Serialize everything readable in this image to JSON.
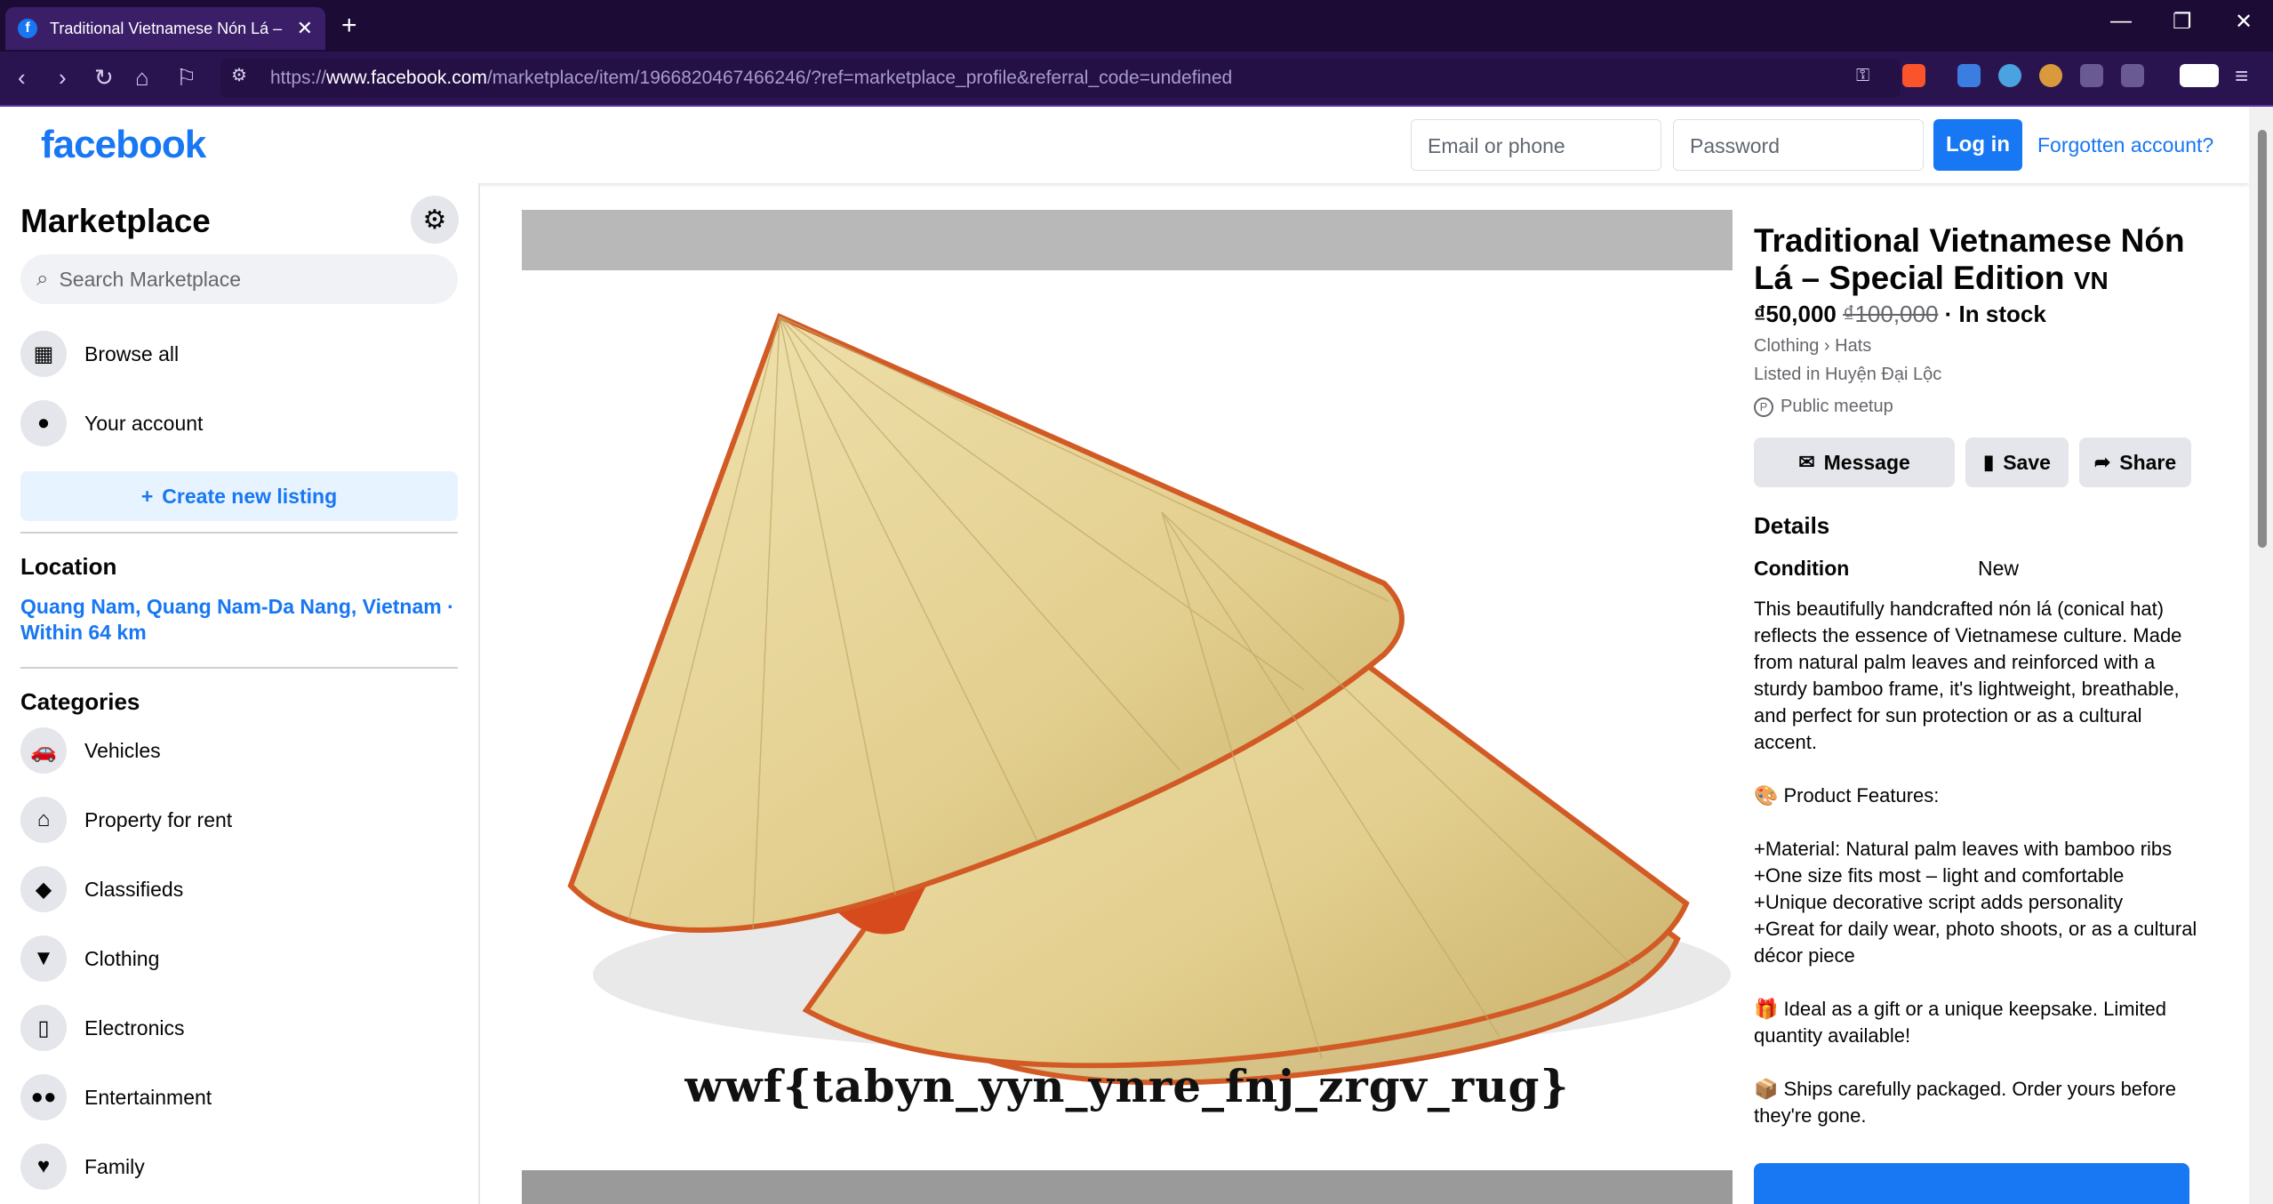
{
  "browser": {
    "tab_title": "Traditional Vietnamese Nón Lá –",
    "url_prefix": "https://",
    "url_host": "www.facebook.com",
    "url_path": "/marketplace/item/1966820467466246/?ref=marketplace_profile&referral_code=undefined"
  },
  "header": {
    "logo": "facebook",
    "email_placeholder": "Email or phone",
    "password_placeholder": "Password",
    "login_label": "Log in",
    "forgot_label": "Forgotten account?"
  },
  "sidebar": {
    "title": "Marketplace",
    "search_placeholder": "Search Marketplace",
    "browse_all": "Browse all",
    "your_account": "Your account",
    "create_listing": "Create new listing",
    "location_title": "Location",
    "location_value": "Quang Nam, Quang Nam-Da Nang, Vietnam · Within 64 km",
    "categories_title": "Categories",
    "categories": [
      {
        "label": "Vehicles",
        "icon": "car-icon"
      },
      {
        "label": "Property for rent",
        "icon": "house-icon"
      },
      {
        "label": "Classifieds",
        "icon": "tag-icon"
      },
      {
        "label": "Clothing",
        "icon": "shirt-icon"
      },
      {
        "label": "Electronics",
        "icon": "phone-icon"
      },
      {
        "label": "Entertainment",
        "icon": "people-icon"
      },
      {
        "label": "Family",
        "icon": "heart-icon"
      }
    ]
  },
  "listing": {
    "image_caption": "wwf{tabyn_yyn_ynre_fnj_zrgv_rug}",
    "title": "Traditional Vietnamese Nón Lá – Special Edition",
    "title_suffix": "VN",
    "price": "₫50,000",
    "old_price": "₫100,000",
    "stock": " · In stock",
    "category_path": "Clothing › Hats",
    "listed_in": "Listed in Huyện Đại Lộc",
    "meetup": "Public meetup",
    "message_label": "Message",
    "save_label": "Save",
    "share_label": "Share",
    "details_title": "Details",
    "condition_label": "Condition",
    "condition_value": "New",
    "description": "This beautifully handcrafted nón lá (conical hat) reflects the essence of Vietnamese culture. Made from natural palm leaves and reinforced with a sturdy bamboo frame, it's lightweight, breathable, and perfect for sun protection or as a cultural accent.\n\n🎨 Product Features:\n\n+Material: Natural palm leaves with bamboo ribs\n+One size fits most – light and comfortable\n+Unique decorative script adds personality\n+Great for daily wear, photo shoots, or as a cultural décor piece\n\n🎁 Ideal as a gift or a unique keepsake. Limited quantity available!\n\n📦 Ships carefully packaged. Order yours before they're gone."
  },
  "colors": {
    "brand": "#1877f2",
    "browser_bg": "#1c0b34"
  }
}
